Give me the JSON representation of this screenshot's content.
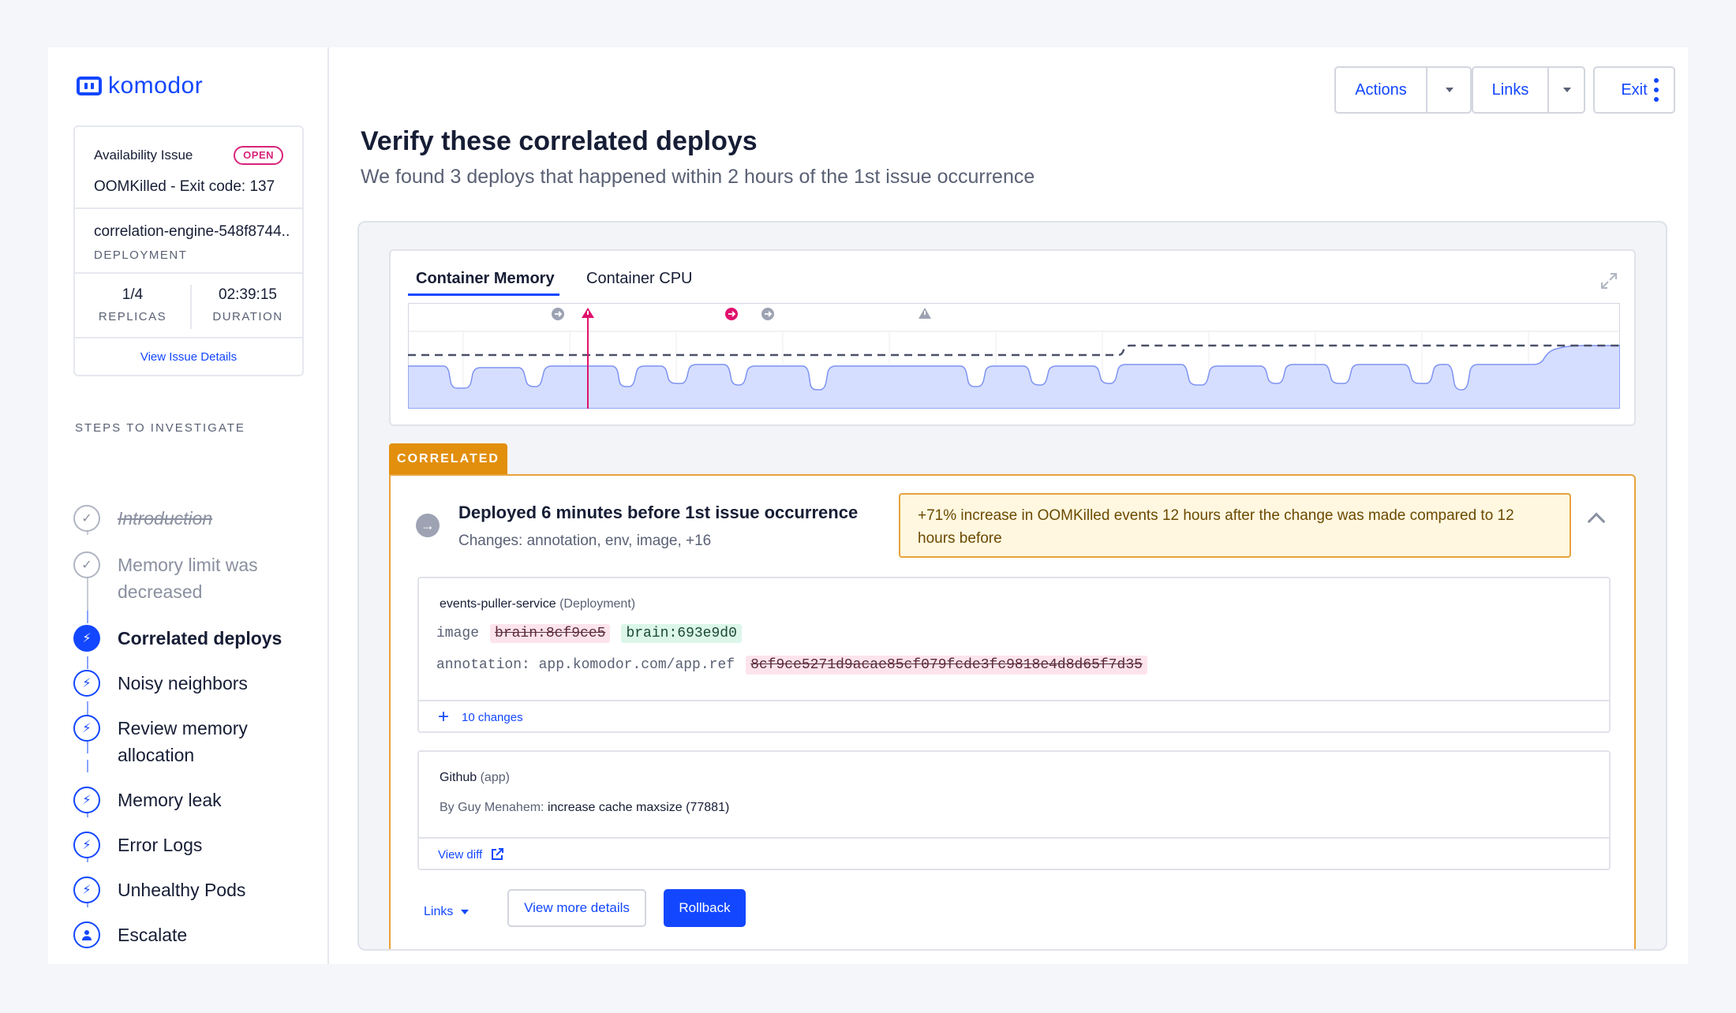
{
  "brand": {
    "name": "komodor",
    "color": "#1347ff"
  },
  "issue": {
    "type": "Availability Issue",
    "status": "OPEN",
    "reason": "OOMKilled - Exit code: 137",
    "service_name": "correlation-engine-548f8744..",
    "service_kind": "DEPLOYMENT",
    "replicas_value": "1/4",
    "replicas_label": "REPLICAS",
    "duration_value": "02:39:15",
    "duration_label": "DURATION",
    "details_link": "View Issue Details"
  },
  "steps": {
    "title": "STEPS TO INVESTIGATE",
    "items": [
      {
        "label": "Introduction",
        "state": "done",
        "icon": "check-icon"
      },
      {
        "label": "Memory limit was decreased",
        "state": "done",
        "icon": "check-icon"
      },
      {
        "label": "Correlated deploys",
        "state": "active",
        "icon": "bolt-icon"
      },
      {
        "label": "Noisy neighbors",
        "state": "todo",
        "icon": "bolt-icon"
      },
      {
        "label": "Review memory allocation",
        "state": "todo",
        "icon": "bolt-icon"
      },
      {
        "label": "Memory leak",
        "state": "todo",
        "icon": "bolt-icon"
      },
      {
        "label": "Error Logs",
        "state": "todo",
        "icon": "bolt-icon"
      },
      {
        "label": "Unhealthy Pods",
        "state": "todo",
        "icon": "bolt-icon"
      },
      {
        "label": "Escalate",
        "state": "todo",
        "icon": "person-icon"
      }
    ]
  },
  "toolbar": {
    "actions": "Actions",
    "links": "Links",
    "exit": "Exit"
  },
  "page": {
    "title": "Verify these correlated deploys",
    "subtitle": "We found 3 deploys that happened within 2 hours of the 1st issue occurrence"
  },
  "chart": {
    "tabs": [
      "Container Memory",
      "Container CPU"
    ],
    "active_tab": "Container Memory",
    "colors": {
      "usage_fill": "#d6deff",
      "usage_line": "#7d93f2",
      "limit_line": "#4a5068",
      "issue_marker": "#e0126e",
      "event_marker": "#9da3b3"
    }
  },
  "correlated": {
    "badge": "CORRELATED",
    "badge_color": "#e28f0d",
    "title": "Deployed 6 minutes before 1st issue occurrence",
    "changes": "Changes: annotation, env, image, +16",
    "alert": "+71% increase in OOMKilled events 12 hours after the change was made compared to 12 hours before",
    "deployment": {
      "name": "events-puller-service",
      "kind": "(Deployment)",
      "image_key": "image",
      "image_old": "brain:8cf9ce5",
      "image_new": "brain:693e9d0",
      "annotation_key": "annotation: app.komodor.com/app.ref",
      "annotation_old": "8cf9ce5271d9acae85cf079fcde3fc9818e4d8d65f7d35",
      "more_changes": "10 changes"
    },
    "github": {
      "name": "Github",
      "kind": "(app)",
      "author_prefix": "By Guy Menahem:",
      "commit": "increase cache maxsize (77881)",
      "view_diff": "View diff"
    },
    "actions": {
      "links": "Links",
      "view_more": "View more details",
      "rollback": "Rollback"
    }
  }
}
